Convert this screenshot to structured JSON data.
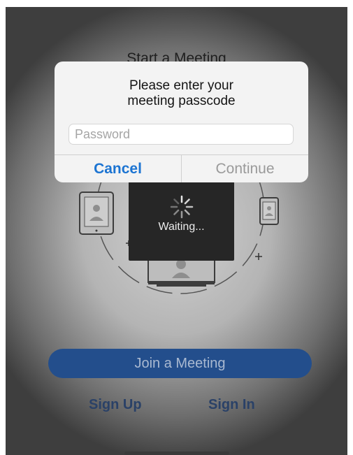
{
  "background": {
    "title": "Start a Meeting",
    "join_button": "Join a Meeting",
    "sign_up": "Sign Up",
    "sign_in": "Sign In"
  },
  "dialog": {
    "title_line1": "Please enter your",
    "title_line2": "meeting passcode",
    "input_placeholder": "Password",
    "input_value": "",
    "cancel_label": "Cancel",
    "continue_label": "Continue"
  },
  "loading": {
    "text": "Waiting..."
  },
  "colors": {
    "accent": "#1c74d2",
    "join_button": "#234e8c",
    "links": "#2a4167"
  },
  "icons": [
    "tablet-icon",
    "phone-icon",
    "laptop-icon",
    "camera-icon",
    "user-icon",
    "spinner-icon",
    "plus-icon"
  ]
}
